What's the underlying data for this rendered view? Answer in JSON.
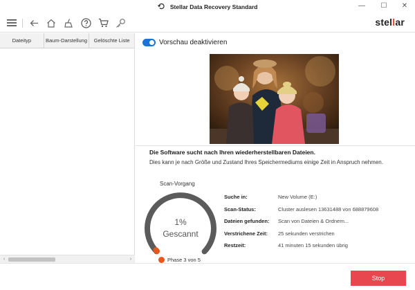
{
  "window": {
    "title": "Stellar Data Recovery Standard",
    "minimize_glyph": "—",
    "maximize_glyph": "☐",
    "close_glyph": "✕"
  },
  "toolbar": {
    "icons": [
      "menu-icon",
      "back-icon",
      "home-icon",
      "clean-icon",
      "help-icon",
      "cart-icon",
      "key-icon"
    ],
    "brand_prefix": "stel",
    "brand_accent": "l",
    "brand_suffix": "ar"
  },
  "left_panel": {
    "tabs": [
      "Dateityp",
      "Baum-Darstellung",
      "Gelöschte Liste"
    ],
    "scroll_left": "‹",
    "scroll_right": "›"
  },
  "preview": {
    "toggle_on": true,
    "toggle_label": "Vorschau deaktivieren"
  },
  "scan": {
    "heading": "Die Software sucht nach Ihren wiederherstellbaren Dateien.",
    "subtext": "Dies kann je nach Größe und Zustand Ihres Speichermediums einige Zeit in Anspruch nehmen.",
    "gauge_label": "Scan-Vorgang",
    "progress_percent": 1,
    "percent_text": "1%",
    "status_text": "Gescannt",
    "phase_text": "Phase 3 von 5",
    "rows": [
      {
        "key": "Suche in:",
        "value": "New Volume (E:)"
      },
      {
        "key": "Scan-Status:",
        "value": "Cluster auslesen 13631488 von 688879608"
      },
      {
        "key": "Dateien gefunden:",
        "value": "Scan von Dateien & Ordnern..."
      },
      {
        "key": "Verstrichene Zeit:",
        "value": "25 sekunden verstrichen"
      },
      {
        "key": "Restzeit:",
        "value": "41 minuten 15 sekunden übrig"
      }
    ]
  },
  "footer": {
    "stop_label": "Stop"
  },
  "colors": {
    "accent_blue": "#1a73d9",
    "stop_red": "#e8474f",
    "brand_red": "#e03a2e",
    "phase_orange": "#e8571d",
    "gauge_track": "#5b5b5b"
  }
}
